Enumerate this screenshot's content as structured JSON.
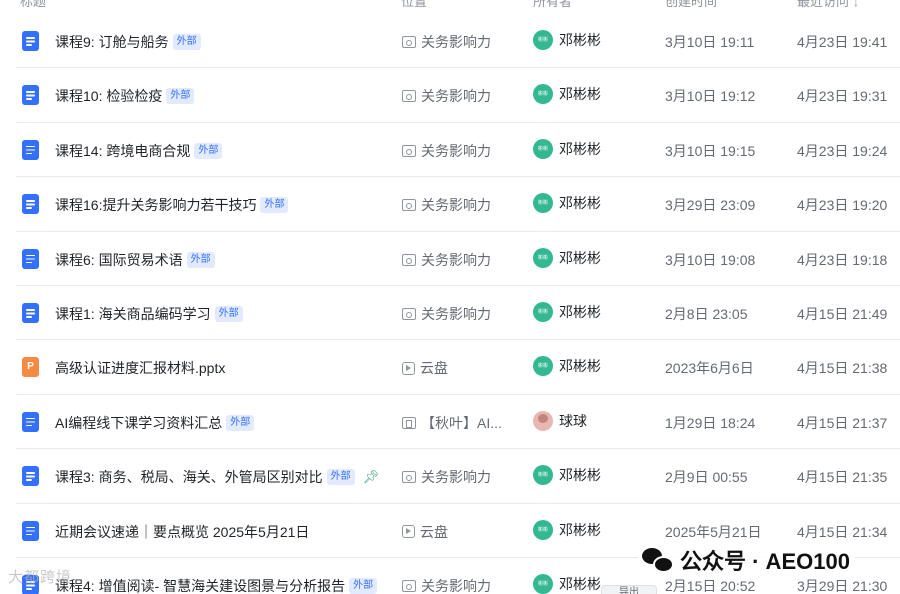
{
  "header": {
    "title": "标题",
    "location": "位置",
    "owner": "所有者",
    "created": "创建时间",
    "visited": "最近访问",
    "sort_icon": "arrow-down-icon"
  },
  "rows": [
    {
      "title": "课程9: 订舱与船务",
      "tag": "外部",
      "type": "doc",
      "location": "关务影响力",
      "loc_icon": "folder",
      "owner": "邓彬彬",
      "created": "3月10日 19:11",
      "visited": "4月23日 19:41"
    },
    {
      "title": "课程10: 检验检疫",
      "tag": "外部",
      "type": "doc",
      "location": "关务影响力",
      "loc_icon": "folder",
      "owner": "邓彬彬",
      "created": "3月10日 19:12",
      "visited": "4月23日 19:31"
    },
    {
      "title": "课程14: 跨境电商合规",
      "tag": "外部",
      "type": "doc",
      "location": "关务影响力",
      "loc_icon": "folder",
      "owner": "邓彬彬",
      "created": "3月10日 19:15",
      "visited": "4月23日 19:24"
    },
    {
      "title": "课程16:提升关务影响力若干技巧",
      "tag": "外部",
      "type": "doc",
      "location": "关务影响力",
      "loc_icon": "folder",
      "owner": "邓彬彬",
      "created": "3月29日 23:09",
      "visited": "4月23日 19:20"
    },
    {
      "title": "课程6: 国际贸易术语",
      "tag": "外部",
      "type": "doc",
      "location": "关务影响力",
      "loc_icon": "folder",
      "owner": "邓彬彬",
      "created": "3月10日 19:08",
      "visited": "4月23日 19:18"
    },
    {
      "title": "课程1: 海关商品编码学习",
      "tag": "外部",
      "type": "doc",
      "location": "关务影响力",
      "loc_icon": "folder",
      "owner": "邓彬彬",
      "created": "2月8日 23:05",
      "visited": "4月15日 21:49"
    },
    {
      "title": "高级认证进度汇报材料.pptx",
      "tag": "",
      "type": "ppt",
      "location": "云盘",
      "loc_icon": "cloud",
      "owner": "邓彬彬",
      "created": "2023年6月6日",
      "visited": "4月15日 21:38"
    },
    {
      "title": "AI编程线下课学习资料汇总",
      "tag": "外部",
      "type": "doc",
      "location": "【秋叶】AI...",
      "loc_icon": "wiki",
      "owner": "球球",
      "owner_photo": true,
      "created": "1月29日 18:24",
      "visited": "4月15日 21:37"
    },
    {
      "title": "课程3: 商务、税局、海关、外管局区别对比",
      "tag": "外部",
      "pinned": true,
      "type": "doc",
      "location": "关务影响力",
      "loc_icon": "folder",
      "owner": "邓彬彬",
      "created": "2月9日 00:55",
      "visited": "4月15日 21:35"
    },
    {
      "title": "近期会议速递｜要点概览 2025年5月21日",
      "tag": "",
      "type": "doc",
      "location": "云盘",
      "loc_icon": "cloud",
      "owner": "邓彬彬",
      "created": "2025年5月21日",
      "visited": "4月15日 21:34"
    },
    {
      "title": "课程4: 增值阅读- 智慧海关建设图景与分析报告",
      "tag": "外部",
      "type": "doc",
      "location": "关务影响力",
      "loc_icon": "folder",
      "owner": "邓彬彬",
      "created": "2月15日 20:52",
      "visited": "3月29日 21:30"
    }
  ],
  "avatar_text": "彬彬",
  "ppt_letter": "P",
  "watermark": {
    "text": "公众号 · AEO100",
    "icon": "wechat-icon"
  },
  "corner_watermark": "大都跨境",
  "toast_label": "导出"
}
